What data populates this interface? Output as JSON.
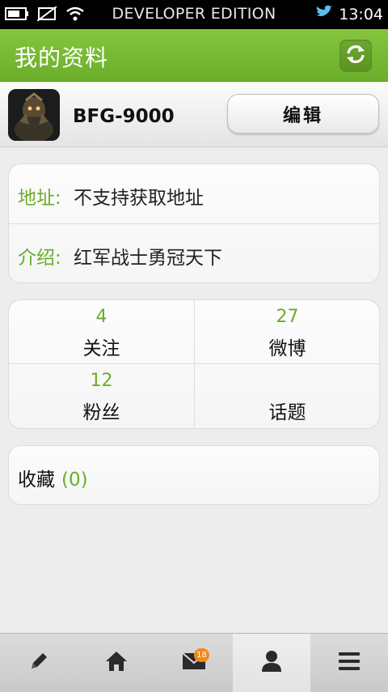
{
  "status_bar": {
    "edition_label": "DEVELOPER EDITION",
    "time": "13:04",
    "icons": [
      "battery-icon",
      "no-sim-icon",
      "wifi-icon",
      "twitter-bird-icon"
    ]
  },
  "header": {
    "title": "我的资料",
    "refresh_icon": "refresh-icon"
  },
  "profile": {
    "username": "BFG-9000",
    "edit_label": "编辑"
  },
  "info": {
    "address_label": "地址:",
    "address_value": "不支持获取地址",
    "bio_label": "介绍:",
    "bio_value": "红军战士勇冠天下"
  },
  "stats": {
    "following": {
      "count": "4",
      "label": "关注"
    },
    "weibo": {
      "count": "27",
      "label": "微博"
    },
    "fans": {
      "count": "12",
      "label": "粉丝"
    },
    "topics": {
      "count": "",
      "label": "话题"
    }
  },
  "favorites": {
    "label": "收藏",
    "count": "(0)"
  },
  "tabbar": {
    "tabs": [
      "compose-icon",
      "home-icon",
      "messages-icon",
      "profile-icon",
      "menu-icon"
    ],
    "message_badge": "18",
    "active_tab": "profile-icon"
  },
  "colors": {
    "accent": "#6aae2a",
    "header_bg": "#78ba35",
    "badge": "#f08a1a"
  }
}
